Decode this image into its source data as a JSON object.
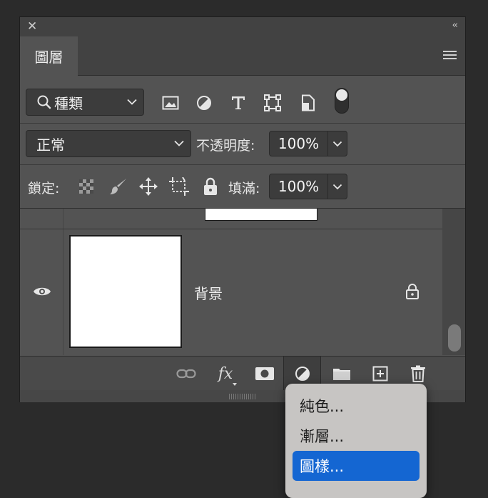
{
  "panel": {
    "tab_label": "圖層",
    "filter": {
      "selected": "種類"
    },
    "blend": {
      "selected": "正常",
      "opacity_label": "不透明度:",
      "opacity_value": "100%"
    },
    "lock": {
      "label": "鎖定:",
      "fill_label": "填滿:",
      "fill_value": "100%"
    }
  },
  "layers": [
    {
      "name": "背景",
      "visible": true,
      "locked": true
    }
  ],
  "popup_menu": {
    "items": [
      {
        "label": "純色..."
      },
      {
        "label": "漸層..."
      },
      {
        "label": "圖樣..."
      }
    ],
    "selected_index": 2
  },
  "colors": {
    "panel_bg": "#535353",
    "app_bg": "#2b2b2b",
    "selection": "#1466d2"
  },
  "icons": [
    "close-icon",
    "collapse-icon",
    "panel-menu-icon",
    "search-icon",
    "pixel-filter-icon",
    "adjustment-filter-icon",
    "type-filter-icon",
    "shape-filter-icon",
    "smart-object-filter-icon",
    "lock-transparent-icon",
    "lock-brush-icon",
    "lock-move-icon",
    "lock-artboard-icon",
    "lock-all-icon",
    "eye-icon",
    "lock-icon",
    "link-icon",
    "fx-icon",
    "mask-icon",
    "adjustment-icon",
    "folder-icon",
    "new-layer-icon",
    "trash-icon"
  ]
}
